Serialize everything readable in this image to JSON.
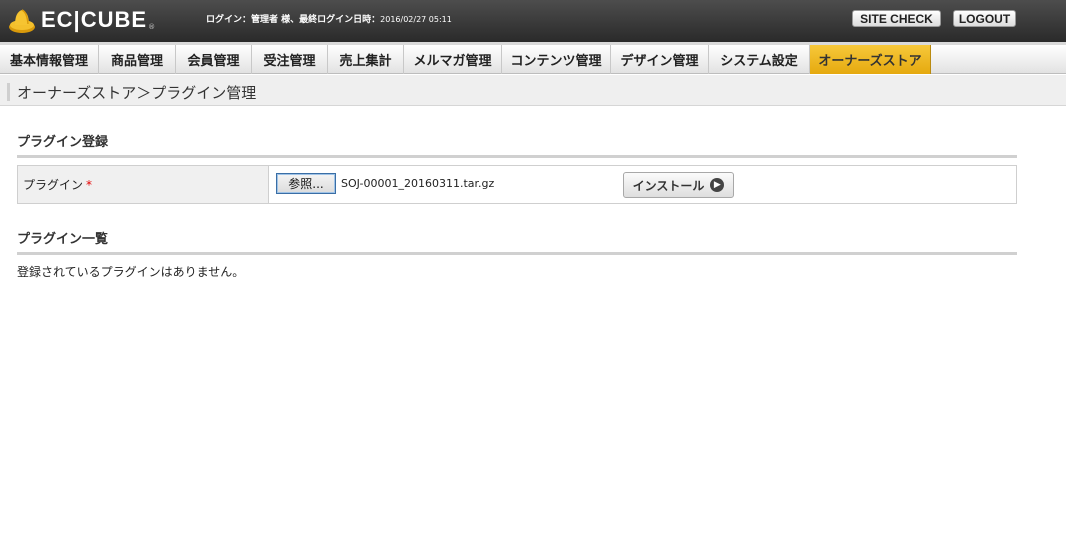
{
  "header": {
    "logo_text": "EC|CUBE",
    "logo_reg": "®",
    "login_label": "ログイン：管理者 様、最終ログイン日時：",
    "login_timestamp": "2016/02/27 05:11",
    "site_check_label": "SITE CHECK",
    "logout_label": "LOGOUT"
  },
  "nav": {
    "items": [
      {
        "label": "基本情報管理"
      },
      {
        "label": "商品管理"
      },
      {
        "label": "会員管理"
      },
      {
        "label": "受注管理"
      },
      {
        "label": "売上集計"
      },
      {
        "label": "メルマガ管理"
      },
      {
        "label": "コンテンツ管理"
      },
      {
        "label": "デザイン管理"
      },
      {
        "label": "システム設定"
      },
      {
        "label": "オーナーズストア"
      }
    ],
    "active": "オーナーズストア"
  },
  "breadcrumb": {
    "text": "オーナーズストア＞プラグイン管理"
  },
  "register": {
    "heading": "プラグイン登録",
    "field_label": "プラグイン",
    "required_mark": "*",
    "browse_label": "参照...",
    "file_name": "SOJ-00001_20160311.tar.gz",
    "install_label": "インストール",
    "install_icon": "arrow-right-circle-icon"
  },
  "list": {
    "heading": "プラグイン一覧",
    "empty_message": "登録されているプラグインはありません。"
  },
  "colors": {
    "header_bg": "#3a3a3a",
    "active_tab": "#f0b828",
    "required": "#e40000"
  }
}
